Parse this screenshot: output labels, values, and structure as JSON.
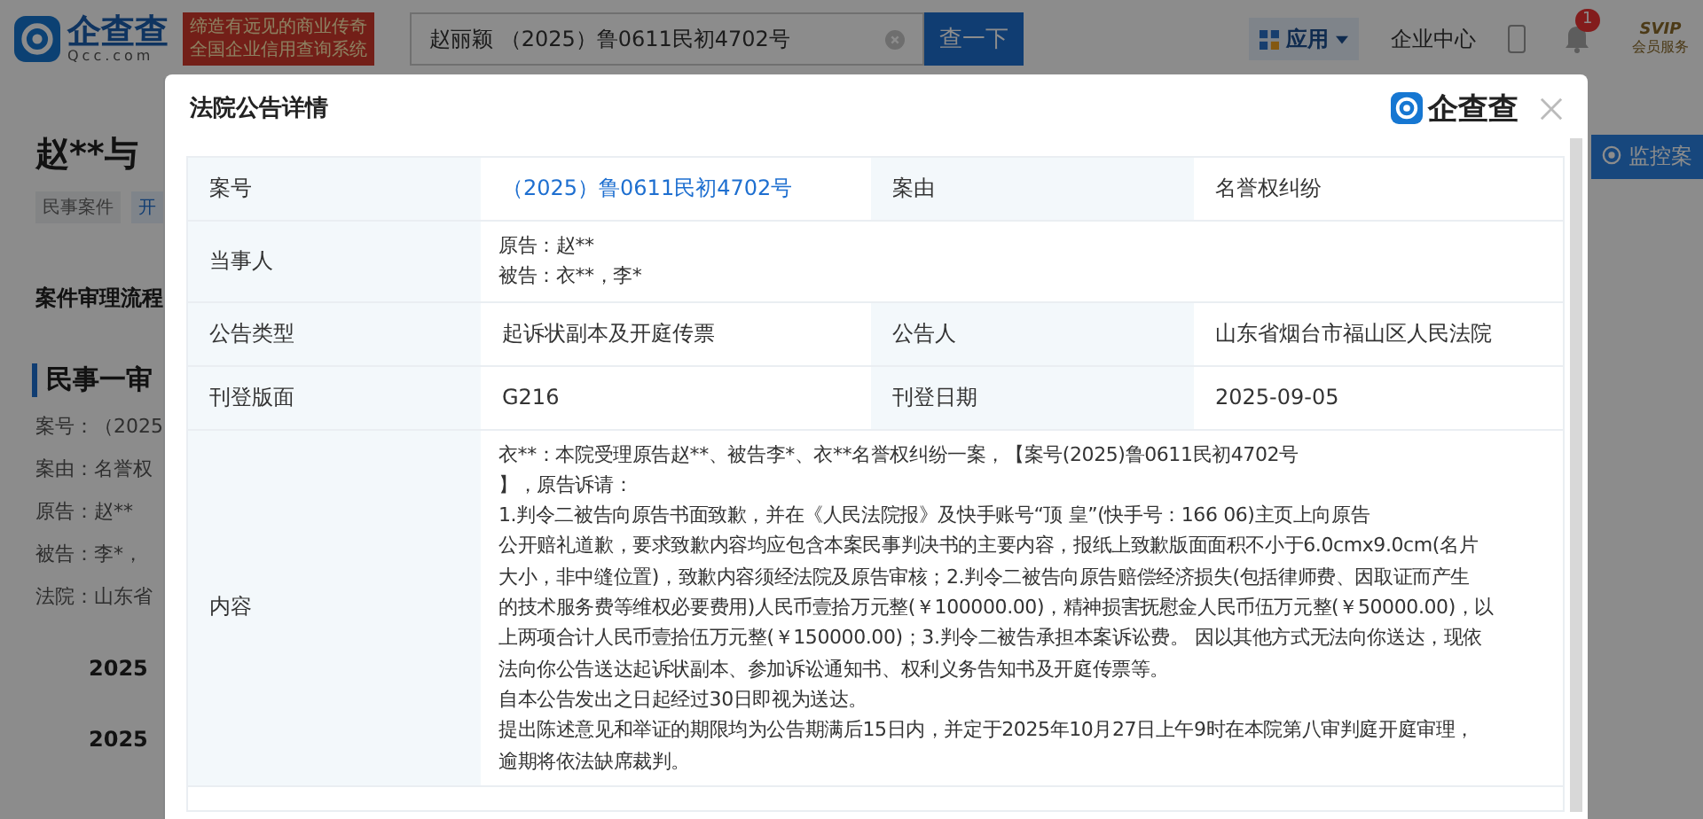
{
  "header": {
    "logo": {
      "name": "企查查",
      "domain": "Qcc.com"
    },
    "slogan": [
      "缔造有远见的商业传奇",
      "全国企业信用查询系统"
    ],
    "search": {
      "value": "赵丽颖 （2025）鲁0611民初4702号"
    },
    "search_button": "查一下",
    "apps_button": "应用",
    "enterprise_center": "企业中心",
    "notification_count": "1",
    "vip": {
      "title": "SVIP",
      "subtitle": "会员服务"
    }
  },
  "page": {
    "title": "赵**与",
    "tags": [
      "民事案件",
      "开"
    ],
    "section": "案件审理流程",
    "stage": "民事一审",
    "fields": [
      "案号：（2025",
      "案由：名誉权",
      "原告：赵**",
      "被告：李*，",
      "法院：山东省"
    ],
    "years": [
      "2025",
      "2025"
    ],
    "monitor_button": "监控案"
  },
  "dialog": {
    "title": "法院公告详情",
    "brand": "企查查",
    "rows": [
      {
        "kind": "pair",
        "cells": [
          {
            "label": "案号",
            "value": "（2025）鲁0611民初4702号",
            "link": true
          },
          {
            "label": "案由",
            "value": "名誉权纠纷",
            "link": false
          }
        ]
      },
      {
        "kind": "wide",
        "label": "当事人",
        "lines": [
          "原告：赵**",
          "被告：衣**，李*"
        ]
      },
      {
        "kind": "pair",
        "cells": [
          {
            "label": "公告类型",
            "value": "起诉状副本及开庭传票",
            "link": false
          },
          {
            "label": "公告人",
            "value": "山东省烟台市福山区人民法院",
            "link": false
          }
        ]
      },
      {
        "kind": "pair",
        "cells": [
          {
            "label": "刊登版面",
            "value": "G216",
            "link": false
          },
          {
            "label": "刊登日期",
            "value": "2025-09-05",
            "link": false
          }
        ]
      },
      {
        "kind": "wide",
        "label": "内容",
        "lines": [
          "衣**：本院受理原告赵**、被告李*、衣**名誉权纠纷一案，【案号(2025)鲁0611民初4702号",
          "】，原告诉请：",
          "1.判令二被告向原告书面致歉，并在《人民法院报》及快手账号“顶  皇”(快手号：166    06)主页上向原告",
          "公开赔礼道歉，要求致歉内容均应包含本案民事判决书的主要内容，报纸上致歉版面面积不小于6.0cmx9.0cm(名片",
          "大小，非中缝位置)，致歉内容须经法院及原告审核；2.判令二被告向原告赔偿经济损失(包括律师费、因取证而产生",
          "的技术服务费等维权必要费用)人民币壹拾万元整(￥100000.00)，精神损害抚慰金人民币伍万元整(￥50000.00)，以",
          "上两项合计人民币壹拾伍万元整(￥150000.00)；3.判令二被告承担本案诉讼费。 因以其他方式无法向你送达，现依",
          "法向你公告送达起诉状副本、参加诉讼通知书、权利义务告知书及开庭传票等。",
          "自本公告发出之日起经过30日即视为送达。",
          "提出陈述意见和举证的期限均为公告期满后15日内，并定于2025年10月27日上午9时在本院第八审判庭开庭审理，",
          "逾期将依法缺席裁判。"
        ]
      }
    ]
  }
}
